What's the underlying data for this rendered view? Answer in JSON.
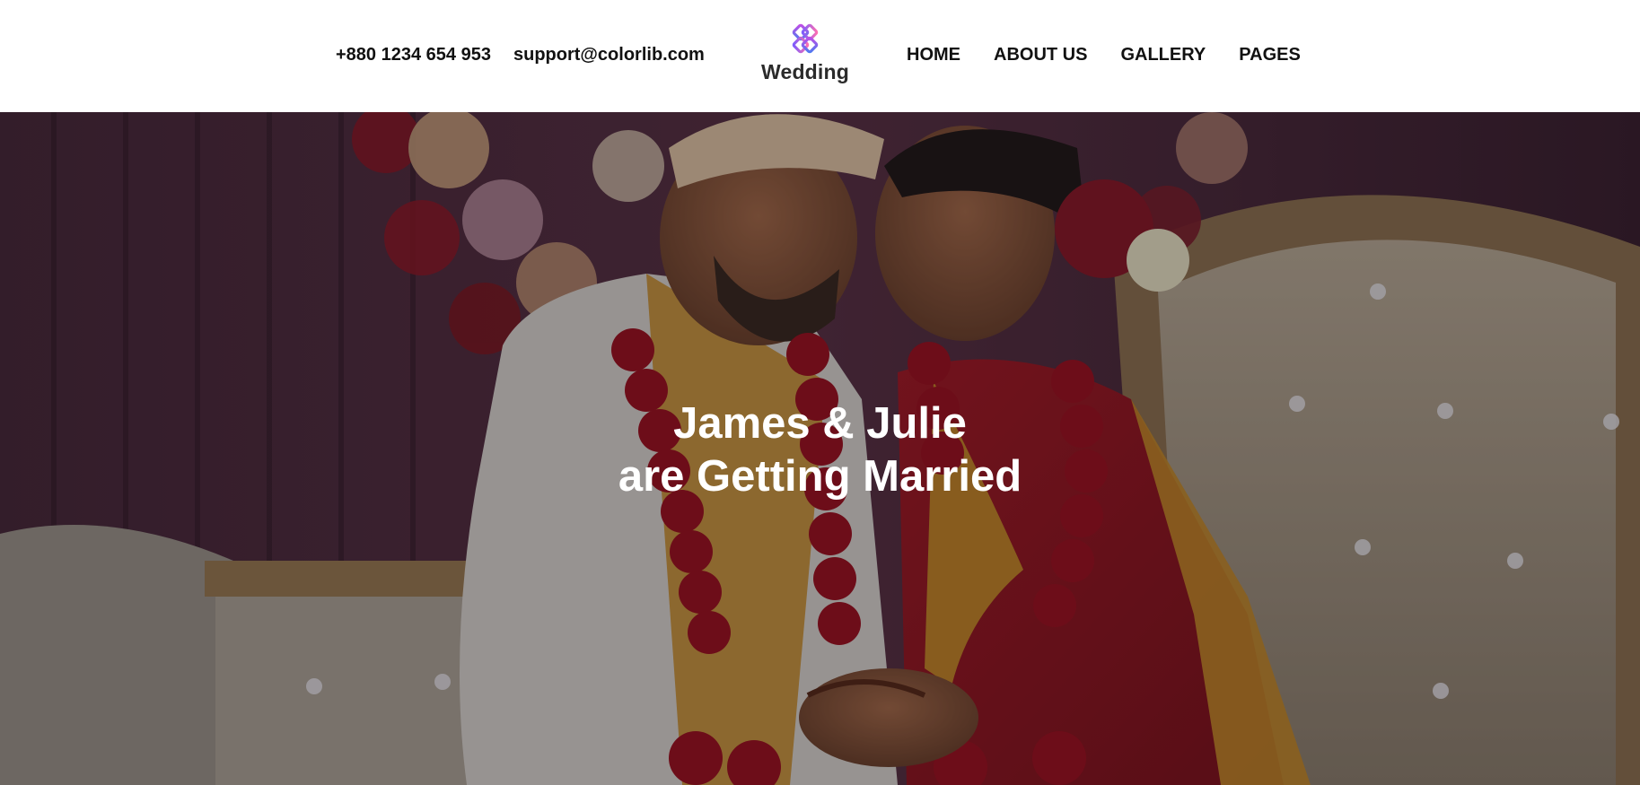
{
  "header": {
    "phone": "+880 1234 654 953",
    "email": "support@colorlib.com",
    "logo": {
      "icon": "colorful-knot-logo-icon",
      "text": "Wedding",
      "colors": [
        "#c04ee6",
        "#4e7af0",
        "#ff6fb1",
        "#7a5cff"
      ]
    },
    "nav": [
      {
        "label": "HOME"
      },
      {
        "label": "ABOUT US"
      },
      {
        "label": "GALLERY"
      },
      {
        "label": "PAGES"
      }
    ]
  },
  "hero": {
    "title_line1": "James & Julie",
    "title_line2": "are Getting Married",
    "image": "wedding-couple-photo",
    "overlay_color": "rgba(0,0,0,0.30)"
  }
}
